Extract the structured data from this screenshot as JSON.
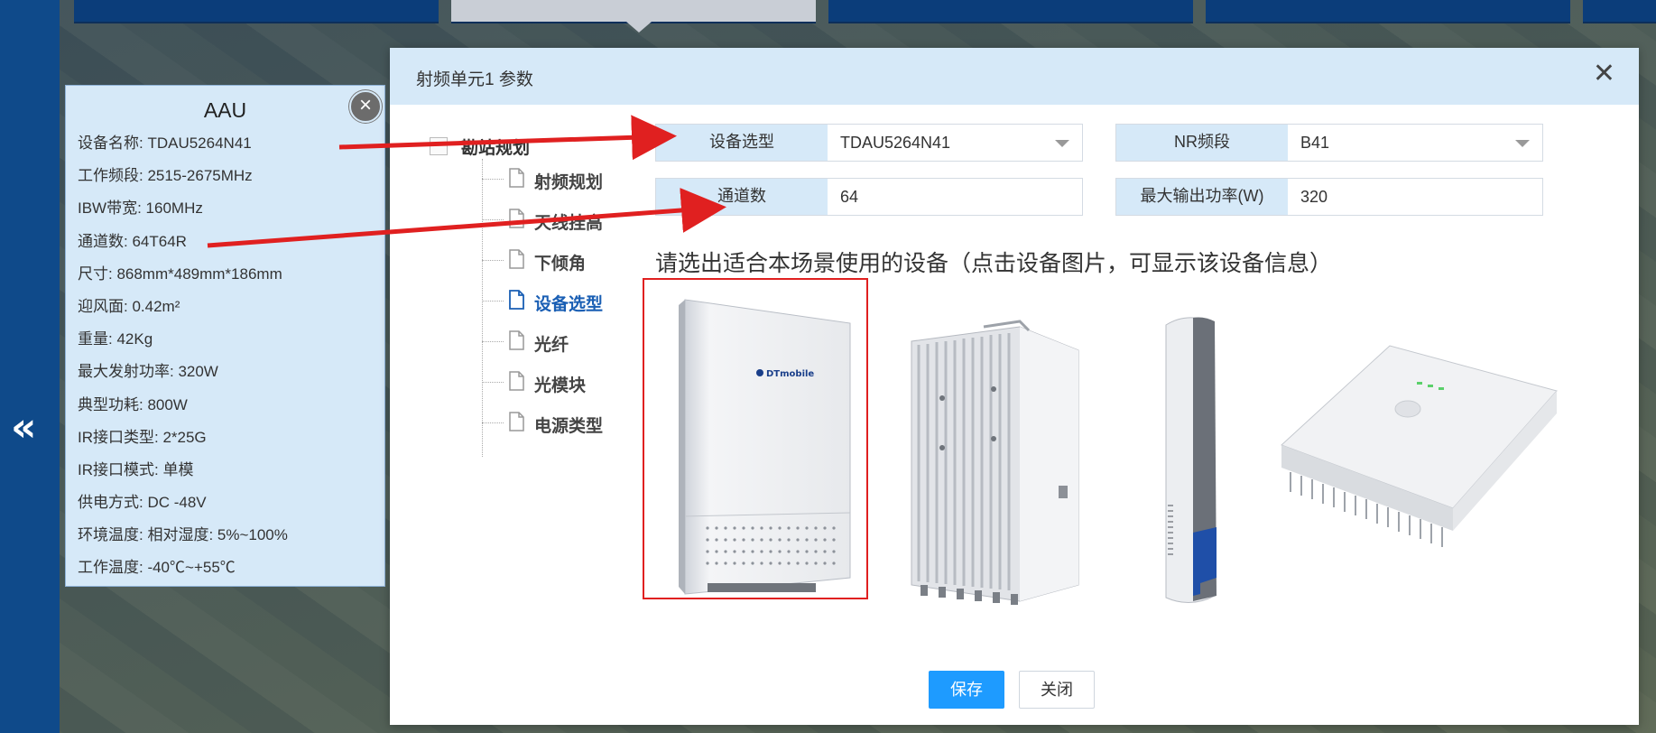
{
  "info_panel": {
    "title": "AAU",
    "lines": [
      "设备名称: TDAU5264N41",
      "工作频段: 2515-2675MHz",
      "IBW带宽: 160MHz",
      "通道数: 64T64R",
      "尺寸: 868mm*489mm*186mm",
      "迎风面: 0.42m²",
      "重量: 42Kg",
      "最大发射功率: 320W",
      "典型功耗: 800W",
      "IR接口类型: 2*25G",
      "IR接口模式: 单模",
      "供电方式: DC -48V",
      "环境温度: 相对湿度:  5%~100%",
      "工作温度: -40℃~+55℃"
    ]
  },
  "dialog": {
    "title": "射频单元1 参数",
    "tree": {
      "root": "勘站规划",
      "items": [
        "射频规划",
        "天线挂高",
        "下倾角",
        "设备选型",
        "光纤",
        "光模块",
        "电源类型"
      ],
      "active": "设备选型"
    },
    "fields": {
      "device_model": {
        "label": "设备选型",
        "value": "TDAU5264N41"
      },
      "nr_band": {
        "label": "NR频段",
        "value": "B41"
      },
      "channels": {
        "label": "通道数",
        "value": "64"
      },
      "max_power": {
        "label": "最大输出功率(W)",
        "value": "320"
      }
    },
    "prompt": "请选出适合本场景使用的设备（点击设备图片，可显示该设备信息）",
    "device_logo_text": "DTmobile",
    "buttons": {
      "save": "保存",
      "close": "关闭"
    }
  },
  "nav": {
    "back_glyph": "«"
  },
  "colors": {
    "accent": "#1e9bff",
    "panel_bg": "#d6e9f8",
    "highlight": "#e02020",
    "rail": "#0f4a8a"
  }
}
